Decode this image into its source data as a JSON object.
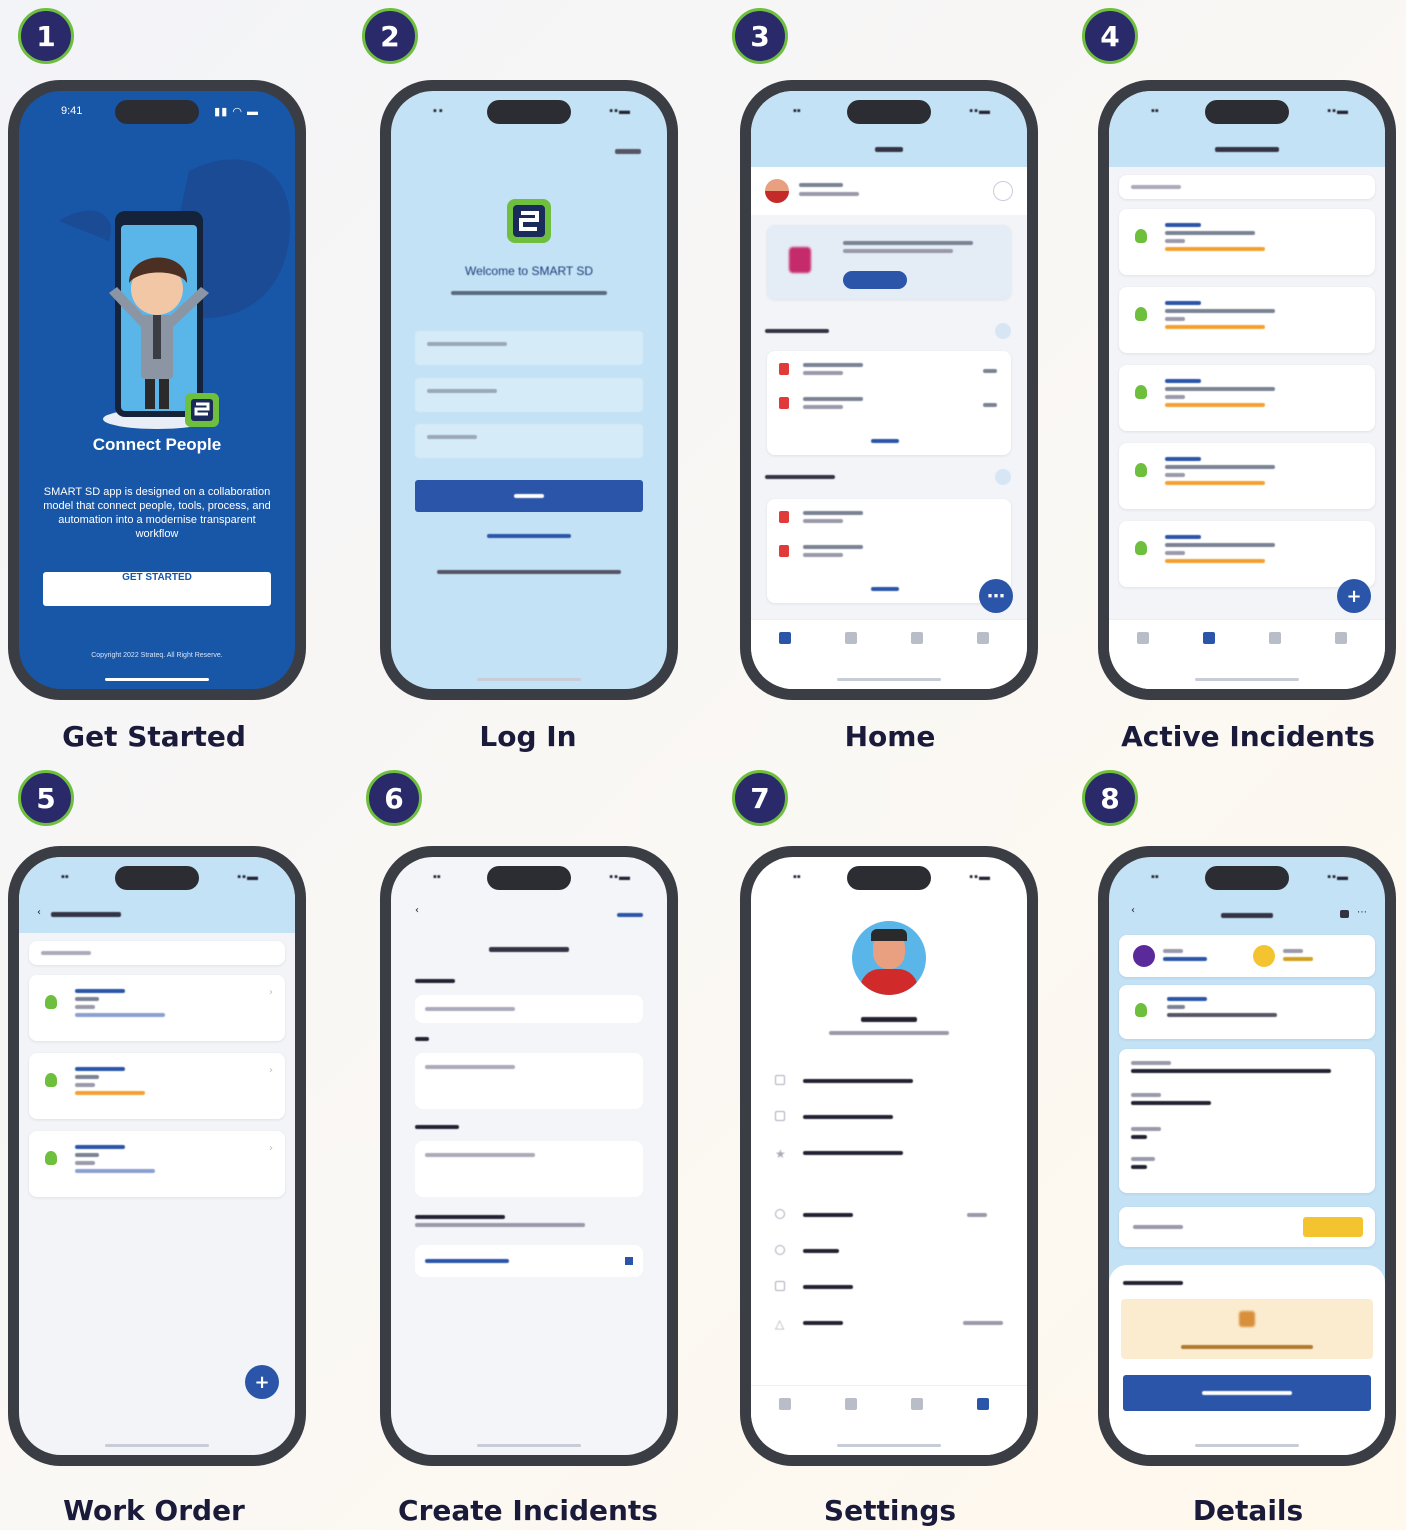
{
  "steps": [
    {
      "number": "1",
      "caption": "Get Started"
    },
    {
      "number": "2",
      "caption": "Log In"
    },
    {
      "number": "3",
      "caption": "Home"
    },
    {
      "number": "4",
      "caption": "Active Incidents"
    },
    {
      "number": "5",
      "caption": "Work Order"
    },
    {
      "number": "6",
      "caption": "Create Incidents"
    },
    {
      "number": "7",
      "caption": "Settings"
    },
    {
      "number": "8",
      "caption": "Details"
    }
  ],
  "status_time": "9:41",
  "get_started": {
    "title": "Connect People",
    "description": "SMART SD app is designed on a collaboration model that connect people, tools, process, and automation into a modernise transparent workflow",
    "button": "GET STARTED",
    "copyright": "Copyright 2022 Strateq. All Right Reserve."
  },
  "login": {
    "welcome": "Welcome to SMART SD"
  },
  "colors": {
    "primary_blue": "#1856a8",
    "light_blue": "#c4e2f5",
    "accent_green": "#6fbf3f",
    "badge_navy": "#2a2a6a",
    "button_blue": "#2a55a8",
    "warning_yellow": "#f4c430"
  },
  "icons": {
    "logo": "smart-sd-logo",
    "fab": "plus-icon",
    "back": "chevron-left-icon",
    "tab_home": "home-icon",
    "tab_incidents": "incident-icon",
    "tab_chat": "chat-icon",
    "tab_settings": "gear-icon"
  }
}
